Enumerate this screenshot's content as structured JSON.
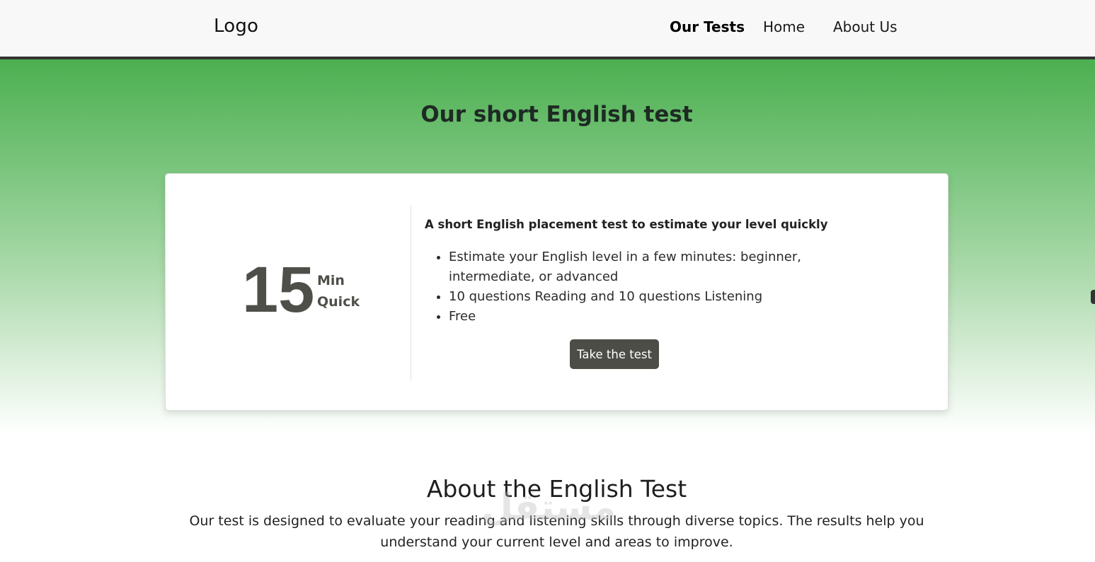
{
  "header": {
    "logo": "Logo",
    "nav": [
      {
        "label": "Our Tests",
        "active": true
      },
      {
        "label": "Home",
        "active": false
      },
      {
        "label": "About Us",
        "active": false
      }
    ]
  },
  "hero": {
    "title": "Our short English test",
    "gradient_colors": [
      "#4caf50",
      "#ffffff"
    ]
  },
  "card": {
    "duration_number": "15",
    "duration_unit": "Min",
    "duration_label": "Quick",
    "subtitle": "A short English placement test to estimate your level quickly",
    "features": [
      "Estimate your English level in a few minutes: beginner, intermediate, or advanced",
      "10 questions Reading and 10 questions Listening",
      "Free"
    ],
    "button_label": "Take the test",
    "button_color": "#4d4d48"
  },
  "about": {
    "title": "About the English Test",
    "text": "Our test is designed to evaluate your reading and listening skills through diverse topics. The results help you understand your current level and areas to improve."
  },
  "watermark": "مستقل"
}
